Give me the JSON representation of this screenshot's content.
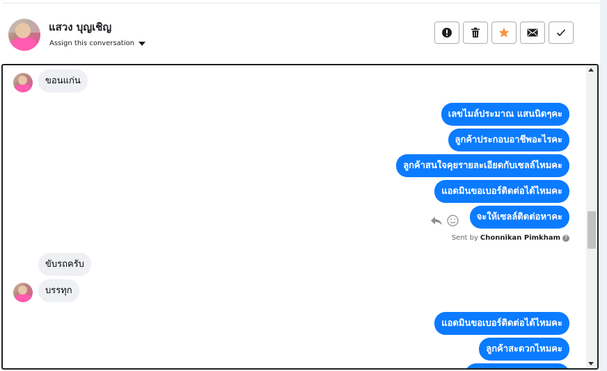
{
  "header": {
    "contact_name": "แสวง บุญเชิญ",
    "assign_label": "Assign this conversation",
    "toolbar": [
      {
        "name": "mark-spam-button",
        "icon": "exclamation-icon"
      },
      {
        "name": "delete-button",
        "icon": "trash-icon"
      },
      {
        "name": "star-button",
        "icon": "star-icon",
        "color": "#f5923e"
      },
      {
        "name": "mark-unread-button",
        "icon": "envelope-icon"
      },
      {
        "name": "mark-done-button",
        "icon": "checkmark-icon"
      }
    ]
  },
  "messages": [
    {
      "direction": "in",
      "text": "ขอนแก่น"
    },
    {
      "direction": "out",
      "text": "เลขไมล์ประมาณ แสนนิดๆคะ"
    },
    {
      "direction": "out",
      "text": "ลูกค้าประกอบอาชีพอะไรคะ"
    },
    {
      "direction": "out",
      "text": "ลูกค้าสนใจคุยรายละเอียดกับเซลล์ไหมคะ"
    },
    {
      "direction": "out",
      "text": "แอดมินขอเบอร์ติดต่อได้ไหมคะ"
    },
    {
      "direction": "out",
      "text": "จะให้เซลล์ติดต่อหาคะ"
    },
    {
      "direction": "in",
      "text": "ขับรถครับ"
    },
    {
      "direction": "in",
      "text": "บรรทุก"
    },
    {
      "direction": "out",
      "text": "แอดมินขอเบอร์ติดต่อได้ไหมคะ"
    },
    {
      "direction": "out",
      "text": "ลูกค้าสะดวกไหมคะ"
    }
  ],
  "sent_by": {
    "prefix": "Sent by",
    "name": "Chonnikan Pimkham",
    "help_icon": "?"
  },
  "colors": {
    "outgoing": "#0b7bff",
    "incoming": "#eef0f3",
    "accent": "#f5923e"
  }
}
